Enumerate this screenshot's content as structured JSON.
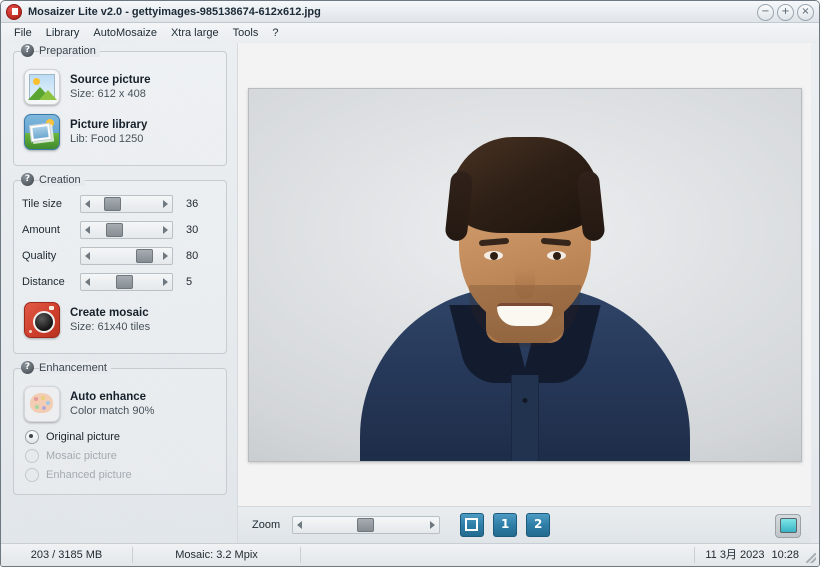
{
  "window": {
    "title": "Mosaizer Lite v2.0 - gettyimages-985138674-612x612.jpg",
    "app_icon": "mosaizer-app-icon",
    "minimize": "−",
    "maximize": "+",
    "close": "×"
  },
  "menu": {
    "items": [
      {
        "label": "File"
      },
      {
        "label": "Library"
      },
      {
        "label": "AutoMosaize"
      },
      {
        "label": "Xtra large"
      },
      {
        "label": "Tools"
      },
      {
        "label": "?"
      }
    ]
  },
  "sidebar": {
    "preparation": {
      "title": "Preparation",
      "help": "?",
      "items": [
        {
          "icon": "picture-icon",
          "title": "Source picture",
          "subtitle": "Size: 612 x 408"
        },
        {
          "icon": "library-icon",
          "title": "Picture library",
          "subtitle": "Lib: Food 1250"
        }
      ]
    },
    "creation": {
      "title": "Creation",
      "help": "?",
      "sliders": [
        {
          "label": "Tile size",
          "value": "36",
          "percent": 28
        },
        {
          "label": "Amount",
          "value": "30",
          "percent": 30
        },
        {
          "label": "Quality",
          "value": "80",
          "percent": 64
        },
        {
          "label": "Distance",
          "value": "5",
          "percent": 40
        }
      ],
      "action": {
        "icon": "camera-icon",
        "title": "Create mosaic",
        "subtitle": "Size: 61x40 tiles"
      }
    },
    "enhancement": {
      "title": "Enhancement",
      "help": "?",
      "action": {
        "icon": "palette-icon",
        "title": "Auto enhance",
        "subtitle": "Color match 90%"
      },
      "radios": [
        {
          "label": "Original picture",
          "checked": true,
          "disabled": false
        },
        {
          "label": "Mosaic picture",
          "checked": false,
          "disabled": true
        },
        {
          "label": "Enhanced picture",
          "checked": false,
          "disabled": true
        }
      ]
    }
  },
  "canvas": {
    "image_alt": "Portrait photo of smiling man in navy blue polo shirt on light grey background"
  },
  "zoombar": {
    "label": "Zoom",
    "slider_percent": 46,
    "buttons": [
      {
        "name": "fit-to-screen",
        "label": ""
      },
      {
        "name": "zoom-1",
        "label": "1"
      },
      {
        "name": "zoom-2",
        "label": "2"
      }
    ],
    "monitor": "monitor-icon"
  },
  "statusbar": {
    "memory": "203 / 3185 MB",
    "mosaic": "Mosaic: 3.2 Mpix",
    "spare": "",
    "date": "11 3月 2023",
    "time": "10:28"
  },
  "colors": {
    "accent_blue": "#2f7fa8",
    "camera_red": "#cf3f2d",
    "monitor_cyan": "#38b4c4"
  }
}
